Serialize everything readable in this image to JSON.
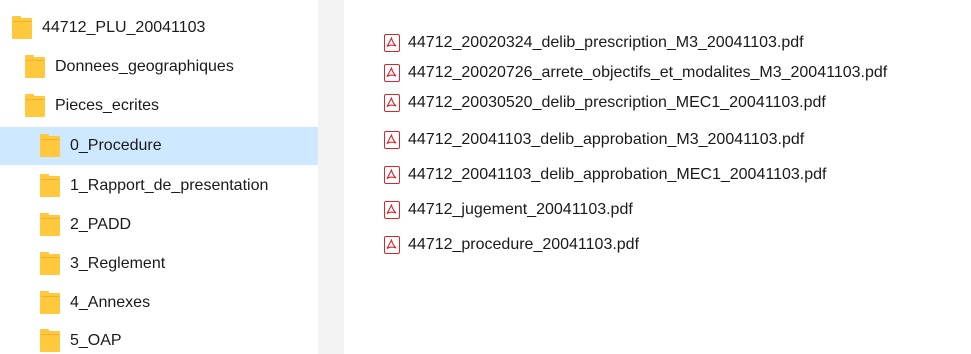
{
  "tree": {
    "items": [
      {
        "label": "44712_PLU_20041103"
      },
      {
        "label": "Donnees_geographiques"
      },
      {
        "label": "Pieces_ecrites"
      },
      {
        "label": "0_Procedure"
      },
      {
        "label": "1_Rapport_de_presentation"
      },
      {
        "label": "2_PADD"
      },
      {
        "label": "3_Reglement"
      },
      {
        "label": "4_Annexes"
      },
      {
        "label": "5_OAP"
      }
    ],
    "selected_index": 3
  },
  "files": {
    "items": [
      {
        "name": "44712_20020324_delib_prescription_M3_20041103.pdf",
        "icon": "pdf-icon"
      },
      {
        "name": "44712_20020726_arrete_objectifs_et_modalites_M3_20041103.pdf",
        "icon": "pdf-icon"
      },
      {
        "name": "44712_20030520_delib_prescription_MEC1_20041103.pdf",
        "icon": "pdf-icon"
      },
      {
        "name": "44712_20041103_delib_approbation_M3_20041103.pdf",
        "icon": "pdf-icon"
      },
      {
        "name": "44712_20041103_delib_approbation_MEC1_20041103.pdf",
        "icon": "pdf-icon"
      },
      {
        "name": "44712_jugement_20041103.pdf",
        "icon": "pdf-icon"
      },
      {
        "name": "44712_procedure_20041103.pdf",
        "icon": "pdf-icon"
      }
    ]
  },
  "colors": {
    "folder": "#ffc83d",
    "selection": "#cde8ff",
    "pdf_red": "#d9252c",
    "pane_divider": "#f3f3f3"
  }
}
